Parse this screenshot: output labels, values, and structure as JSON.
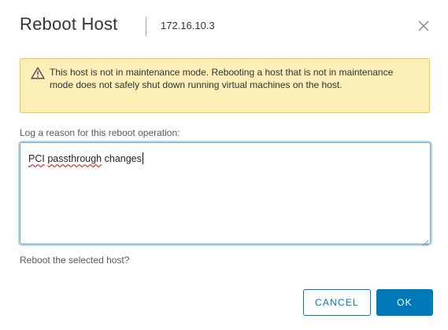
{
  "dialog": {
    "title": "Reboot Host",
    "host_ip": "172.16.10.3",
    "close_icon": "close-icon"
  },
  "alert": {
    "icon": "warning-icon",
    "message": "This host is not in maintenance mode. Rebooting a host that is not in maintenance mode does not safely shut down running virtual machines on the host."
  },
  "reason": {
    "label": "Log a reason for this reboot operation:",
    "value_parts": [
      "PCI",
      " ",
      "passthrough",
      " changes"
    ]
  },
  "confirm_text": "Reboot the selected host?",
  "buttons": {
    "cancel": "CANCEL",
    "ok": "OK"
  },
  "colors": {
    "primary": "#0079b8",
    "warning_bg": "#fbeeb7",
    "warning_border": "#f0c946"
  }
}
